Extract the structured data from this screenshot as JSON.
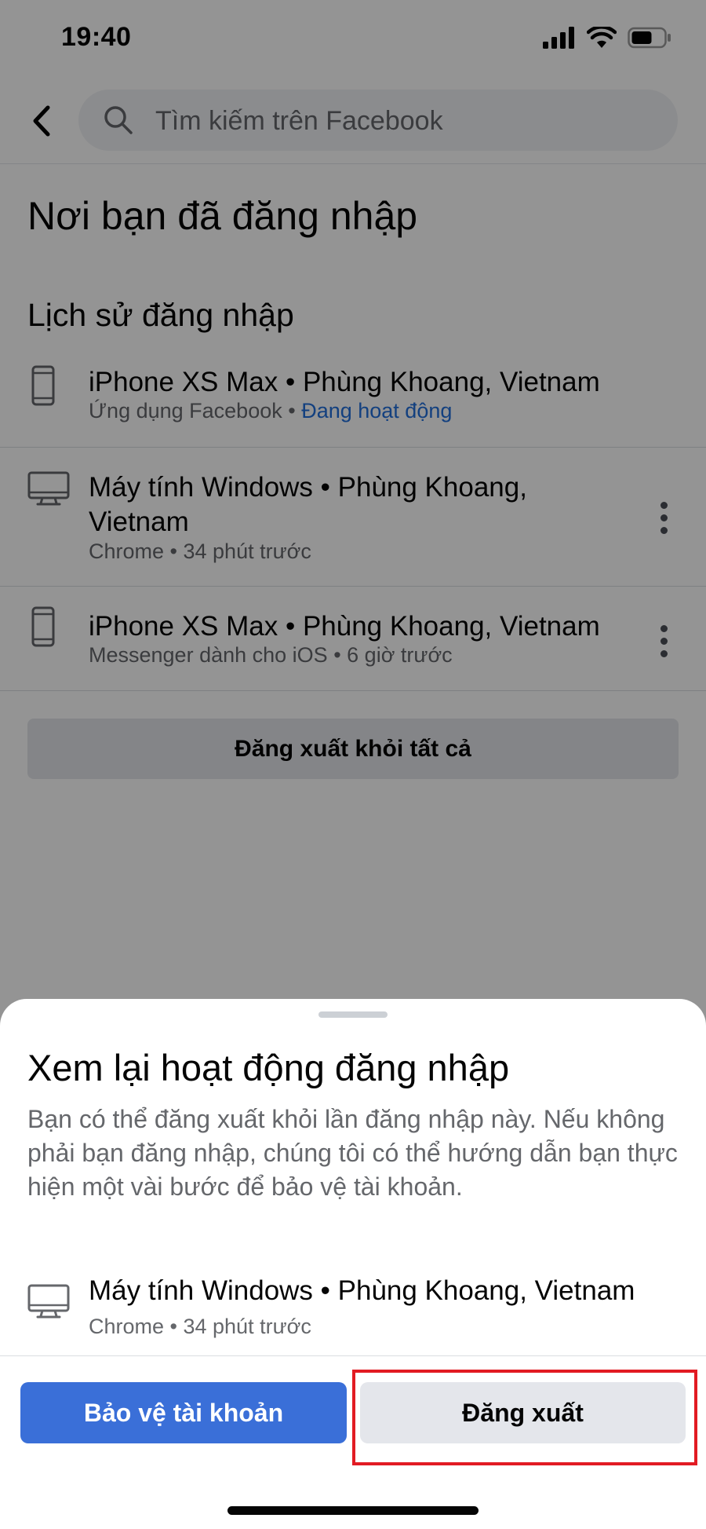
{
  "status_bar": {
    "time": "19:40"
  },
  "header": {
    "search_placeholder": "Tìm kiếm trên Facebook"
  },
  "page_title": "Nơi bạn đã đăng nhập",
  "section_title": "Lịch sử đăng nhập",
  "sessions": [
    {
      "title": "iPhone XS Max • Phùng Khoang, Vietnam",
      "app": "Ứng dụng Facebook",
      "separator": " • ",
      "status": "Đang hoạt động",
      "icon": "phone-icon"
    },
    {
      "title": "Máy tính Windows • Phùng Khoang, Vietnam",
      "app": "Chrome",
      "separator": " • ",
      "status": "34 phút trước",
      "icon": "desktop-icon"
    },
    {
      "title": "iPhone XS Max • Phùng Khoang, Vietnam",
      "app": "Messenger dành cho iOS",
      "separator": " • ",
      "status": "6 giờ trước",
      "icon": "phone-icon"
    }
  ],
  "logout_all_label": "Đăng xuất khỏi tất cả",
  "sheet": {
    "title": "Xem lại hoạt động đăng nhập",
    "description": "Bạn có thể đăng xuất khỏi lần đăng nhập này. Nếu không phải bạn đăng nhập, chúng tôi có thể hướng dẫn bạn thực hiện một vài bước để bảo vệ tài khoản.",
    "device": {
      "title": "Máy tính Windows • Phùng Khoang, Vietnam",
      "meta": "Chrome • 34 phút trước",
      "icon": "desktop-icon"
    },
    "primary_button": "Bảo vệ tài khoản",
    "secondary_button": "Đăng xuất"
  },
  "colors": {
    "accent": "#3a6fd8",
    "active_status": "#216fdb",
    "highlight": "#e21b23"
  }
}
